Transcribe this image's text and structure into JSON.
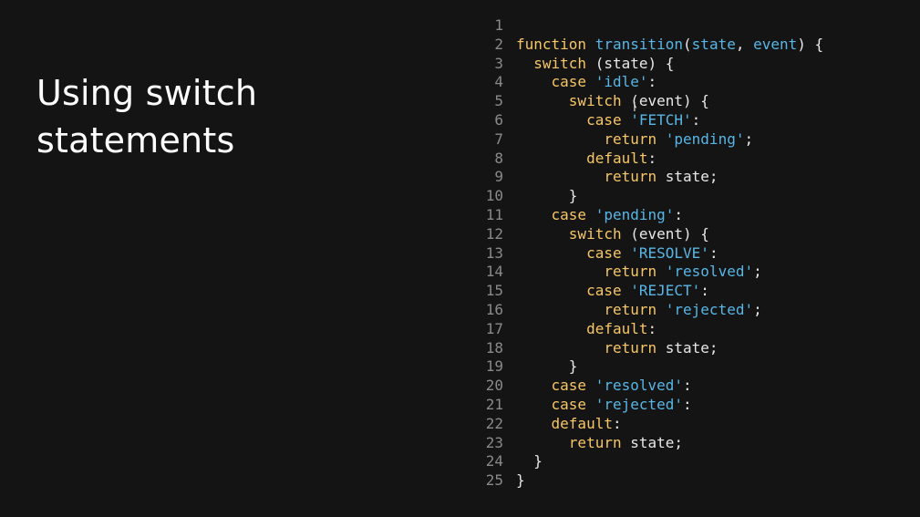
{
  "slide": {
    "title_line1": "Using switch",
    "title_line2": "statements",
    "cursor_glyph": "I"
  },
  "colors": {
    "background": "#141414",
    "keyword": "#f6c667",
    "function_and_string": "#58b6e6",
    "plain": "#e8e8e8",
    "line_number": "#8a8a8a"
  },
  "code": {
    "lines": [
      {
        "n": "1",
        "tokens": []
      },
      {
        "n": "2",
        "tokens": [
          [
            "kw",
            "function"
          ],
          [
            "plain",
            " "
          ],
          [
            "fn",
            "transition"
          ],
          [
            "plain",
            "("
          ],
          [
            "fn",
            "state"
          ],
          [
            "plain",
            ", "
          ],
          [
            "fn",
            "event"
          ],
          [
            "plain",
            ") {"
          ]
        ]
      },
      {
        "n": "3",
        "tokens": [
          [
            "plain",
            "  "
          ],
          [
            "kw",
            "switch"
          ],
          [
            "plain",
            " (state) {"
          ]
        ]
      },
      {
        "n": "4",
        "tokens": [
          [
            "plain",
            "    "
          ],
          [
            "kw",
            "case"
          ],
          [
            "plain",
            " "
          ],
          [
            "str",
            "'idle'"
          ],
          [
            "plain",
            ":"
          ]
        ]
      },
      {
        "n": "5",
        "tokens": [
          [
            "plain",
            "      "
          ],
          [
            "kw",
            "switch"
          ],
          [
            "plain",
            " (event) {"
          ]
        ]
      },
      {
        "n": "6",
        "tokens": [
          [
            "plain",
            "        "
          ],
          [
            "kw",
            "case"
          ],
          [
            "plain",
            " "
          ],
          [
            "str",
            "'FETCH'"
          ],
          [
            "plain",
            ":"
          ]
        ]
      },
      {
        "n": "7",
        "tokens": [
          [
            "plain",
            "          "
          ],
          [
            "kw",
            "return"
          ],
          [
            "plain",
            " "
          ],
          [
            "str",
            "'pending'"
          ],
          [
            "plain",
            ";"
          ]
        ]
      },
      {
        "n": "8",
        "tokens": [
          [
            "plain",
            "        "
          ],
          [
            "kw",
            "default"
          ],
          [
            "plain",
            ":"
          ]
        ]
      },
      {
        "n": "9",
        "tokens": [
          [
            "plain",
            "          "
          ],
          [
            "kw",
            "return"
          ],
          [
            "plain",
            " state;"
          ]
        ]
      },
      {
        "n": "10",
        "tokens": [
          [
            "plain",
            "      }"
          ]
        ]
      },
      {
        "n": "11",
        "tokens": [
          [
            "plain",
            "    "
          ],
          [
            "kw",
            "case"
          ],
          [
            "plain",
            " "
          ],
          [
            "str",
            "'pending'"
          ],
          [
            "plain",
            ":"
          ]
        ]
      },
      {
        "n": "12",
        "tokens": [
          [
            "plain",
            "      "
          ],
          [
            "kw",
            "switch"
          ],
          [
            "plain",
            " (event) {"
          ]
        ]
      },
      {
        "n": "13",
        "tokens": [
          [
            "plain",
            "        "
          ],
          [
            "kw",
            "case"
          ],
          [
            "plain",
            " "
          ],
          [
            "str",
            "'RESOLVE'"
          ],
          [
            "plain",
            ":"
          ]
        ]
      },
      {
        "n": "14",
        "tokens": [
          [
            "plain",
            "          "
          ],
          [
            "kw",
            "return"
          ],
          [
            "plain",
            " "
          ],
          [
            "str",
            "'resolved'"
          ],
          [
            "plain",
            ";"
          ]
        ]
      },
      {
        "n": "15",
        "tokens": [
          [
            "plain",
            "        "
          ],
          [
            "kw",
            "case"
          ],
          [
            "plain",
            " "
          ],
          [
            "str",
            "'REJECT'"
          ],
          [
            "plain",
            ":"
          ]
        ]
      },
      {
        "n": "16",
        "tokens": [
          [
            "plain",
            "          "
          ],
          [
            "kw",
            "return"
          ],
          [
            "plain",
            " "
          ],
          [
            "str",
            "'rejected'"
          ],
          [
            "plain",
            ";"
          ]
        ]
      },
      {
        "n": "17",
        "tokens": [
          [
            "plain",
            "        "
          ],
          [
            "kw",
            "default"
          ],
          [
            "plain",
            ":"
          ]
        ]
      },
      {
        "n": "18",
        "tokens": [
          [
            "plain",
            "          "
          ],
          [
            "kw",
            "return"
          ],
          [
            "plain",
            " state;"
          ]
        ]
      },
      {
        "n": "19",
        "tokens": [
          [
            "plain",
            "      }"
          ]
        ]
      },
      {
        "n": "20",
        "tokens": [
          [
            "plain",
            "    "
          ],
          [
            "kw",
            "case"
          ],
          [
            "plain",
            " "
          ],
          [
            "str",
            "'resolved'"
          ],
          [
            "plain",
            ":"
          ]
        ]
      },
      {
        "n": "21",
        "tokens": [
          [
            "plain",
            "    "
          ],
          [
            "kw",
            "case"
          ],
          [
            "plain",
            " "
          ],
          [
            "str",
            "'rejected'"
          ],
          [
            "plain",
            ":"
          ]
        ]
      },
      {
        "n": "22",
        "tokens": [
          [
            "plain",
            "    "
          ],
          [
            "kw",
            "default"
          ],
          [
            "plain",
            ":"
          ]
        ]
      },
      {
        "n": "23",
        "tokens": [
          [
            "plain",
            "      "
          ],
          [
            "kw",
            "return"
          ],
          [
            "plain",
            " state;"
          ]
        ]
      },
      {
        "n": "24",
        "tokens": [
          [
            "plain",
            "  }"
          ]
        ]
      },
      {
        "n": "25",
        "tokens": [
          [
            "plain",
            "}"
          ]
        ]
      }
    ]
  }
}
